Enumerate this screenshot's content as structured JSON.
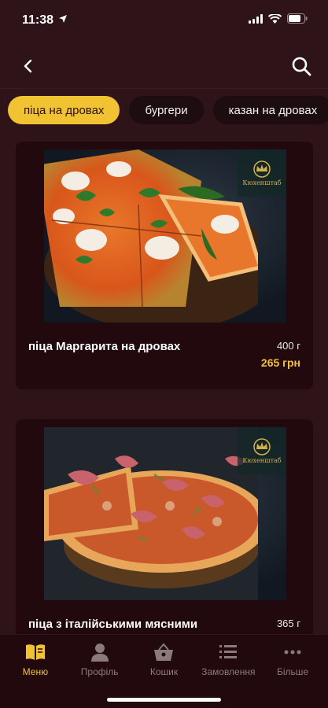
{
  "status_bar": {
    "time": "11:38"
  },
  "categories": [
    {
      "label": "піца на дровах",
      "active": true
    },
    {
      "label": "бургери",
      "active": false
    },
    {
      "label": "казан на дровах",
      "active": false
    }
  ],
  "products": [
    {
      "title": "піца Маргарита на дровах",
      "weight": "400 г",
      "price": "265 грн",
      "logo_text": "Кюхенштаб"
    },
    {
      "title": "піца з італійськими мясними",
      "weight": "365 г",
      "price": "",
      "logo_text": "Кюхенштаб"
    }
  ],
  "tabbar": [
    {
      "label": "Меню",
      "icon": "book-icon",
      "active": true
    },
    {
      "label": "Профіль",
      "icon": "user-icon",
      "active": false
    },
    {
      "label": "Кошик",
      "icon": "basket-icon",
      "active": false
    },
    {
      "label": "Замовлення",
      "icon": "list-icon",
      "active": false
    },
    {
      "label": "Більше",
      "icon": "more-icon",
      "active": false
    }
  ],
  "colors": {
    "background": "#2e1318",
    "card": "#22090d",
    "accent": "#f1c232",
    "inactive": "#8a7a7c"
  }
}
